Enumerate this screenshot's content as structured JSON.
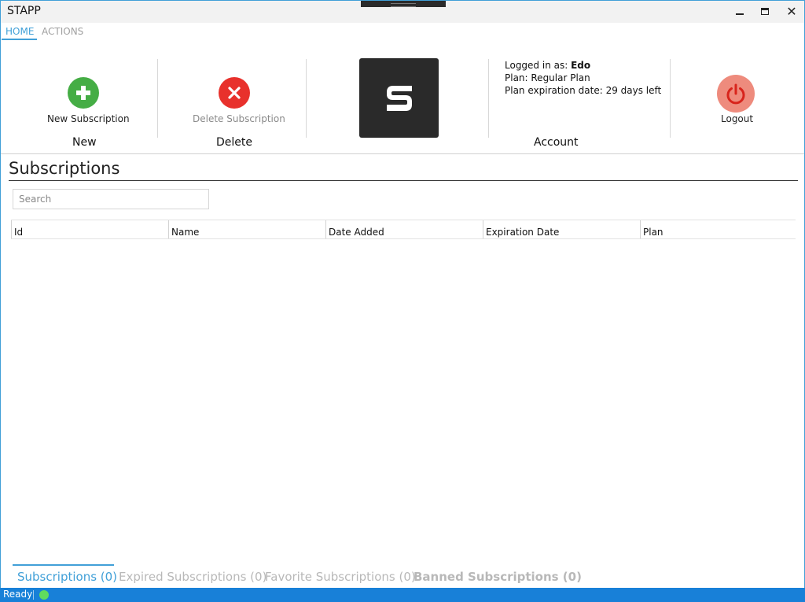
{
  "window": {
    "title": "STAPP",
    "close_glyph": "✕"
  },
  "ribbon_tabs": [
    {
      "label": "HOME",
      "active": true
    },
    {
      "label": "ACTIONS",
      "active": false
    }
  ],
  "ribbon": {
    "new": {
      "button_label": "New Subscription",
      "group_label": "New",
      "icon": "plus-icon",
      "color": "#45ad45"
    },
    "delete": {
      "button_label": "Delete Subscription",
      "group_label": "Delete",
      "icon": "close-icon",
      "color": "#e8312c"
    },
    "logo": {
      "letter": "S"
    },
    "account": {
      "logged_in_prefix": "Logged in as: ",
      "username": "Edo",
      "plan_line": "Plan: Regular Plan",
      "expiration_line": "Plan expiration date: 29 days left",
      "group_label": "Account"
    },
    "logout": {
      "button_label": "Logout",
      "icon": "power-icon",
      "color": "#ee8b7d"
    }
  },
  "main": {
    "title": "Subscriptions",
    "search_placeholder": "Search",
    "columns": [
      "Id",
      "Name",
      "Date Added",
      "Expiration Date",
      "Plan"
    ],
    "rows": []
  },
  "bottom_tabs": [
    {
      "label": "Subscriptions (0)",
      "active": true
    },
    {
      "label": "Expired Subscriptions (0)",
      "active": false
    },
    {
      "label": "Favorite Subscriptions (0)",
      "active": false
    },
    {
      "label": "Banned Subscriptions (0)",
      "active": false
    }
  ],
  "status": {
    "text": "Ready",
    "indicator_color": "#5fdc5f",
    "accent_color": "#1880d8"
  }
}
